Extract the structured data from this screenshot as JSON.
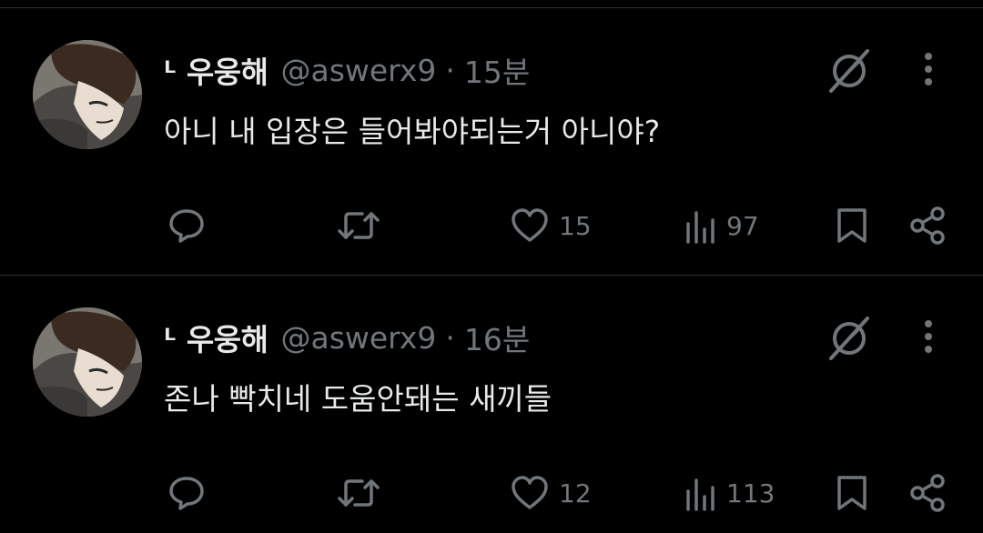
{
  "tweets": [
    {
      "name": "ᒻ 우웅해",
      "handle": "@aswerx9",
      "separator": "·",
      "time": "15분",
      "text": "아니 내 입장은 들어봐야되는거 아니야?",
      "likes": "15",
      "views": "97"
    },
    {
      "name": "ᒻ 우웅해",
      "handle": "@aswerx9",
      "separator": "·",
      "time": "16분",
      "text": "존나 빡치네 도움안돼는 새끼들",
      "likes": "12",
      "views": "113"
    }
  ],
  "icons": {
    "reply": "reply-icon",
    "retweet": "retweet-icon",
    "like": "heart-icon",
    "views": "views-icon",
    "bookmark": "bookmark-icon",
    "share": "share-icon",
    "grok": "grok-icon",
    "more": "more-icon"
  },
  "colors": {
    "background": "#000000",
    "primary_text": "#e7e9ea",
    "secondary_text": "#71767b",
    "divider": "#2f3336"
  }
}
